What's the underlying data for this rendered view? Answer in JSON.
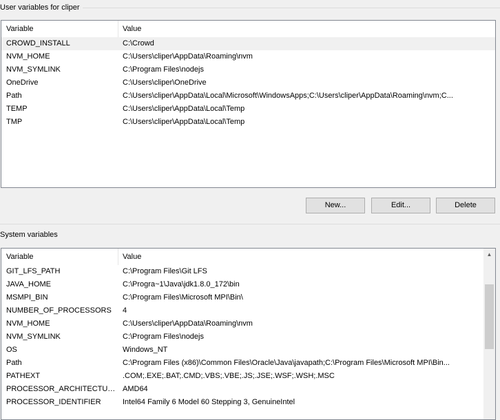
{
  "user_group": {
    "title": "User variables for cliper",
    "columns": [
      "Variable",
      "Value"
    ],
    "rows": [
      {
        "variable": "CROWD_INSTALL",
        "value": "C:\\Crowd",
        "selected": true
      },
      {
        "variable": "NVM_HOME",
        "value": "C:\\Users\\cliper\\AppData\\Roaming\\nvm"
      },
      {
        "variable": "NVM_SYMLINK",
        "value": "C:\\Program Files\\nodejs"
      },
      {
        "variable": "OneDrive",
        "value": "C:\\Users\\cliper\\OneDrive"
      },
      {
        "variable": "Path",
        "value": "C:\\Users\\cliper\\AppData\\Local\\Microsoft\\WindowsApps;C:\\Users\\cliper\\AppData\\Roaming\\nvm;C..."
      },
      {
        "variable": "TEMP",
        "value": "C:\\Users\\cliper\\AppData\\Local\\Temp"
      },
      {
        "variable": "TMP",
        "value": "C:\\Users\\cliper\\AppData\\Local\\Temp"
      }
    ],
    "buttons": {
      "new": "New...",
      "edit": "Edit...",
      "delete": "Delete"
    }
  },
  "system_group": {
    "title": "System variables",
    "columns": [
      "Variable",
      "Value"
    ],
    "rows": [
      {
        "variable": "GIT_LFS_PATH",
        "value": "C:\\Program Files\\Git LFS"
      },
      {
        "variable": "JAVA_HOME",
        "value": "C:\\Progra~1\\Java\\jdk1.8.0_172\\bin"
      },
      {
        "variable": "MSMPI_BIN",
        "value": "C:\\Program Files\\Microsoft MPI\\Bin\\"
      },
      {
        "variable": "NUMBER_OF_PROCESSORS",
        "value": "4"
      },
      {
        "variable": "NVM_HOME",
        "value": "C:\\Users\\cliper\\AppData\\Roaming\\nvm"
      },
      {
        "variable": "NVM_SYMLINK",
        "value": "C:\\Program Files\\nodejs"
      },
      {
        "variable": "OS",
        "value": "Windows_NT"
      },
      {
        "variable": "Path",
        "value": "C:\\Program Files (x86)\\Common Files\\Oracle\\Java\\javapath;C:\\Program Files\\Microsoft MPI\\Bin..."
      },
      {
        "variable": "PATHEXT",
        "value": ".COM;.EXE;.BAT;.CMD;.VBS;.VBE;.JS;.JSE;.WSF;.WSH;.MSC"
      },
      {
        "variable": "PROCESSOR_ARCHITECTURE",
        "value": "AMD64"
      },
      {
        "variable": "PROCESSOR_IDENTIFIER",
        "value": "Intel64 Family 6 Model 60 Stepping 3, GenuineIntel"
      }
    ],
    "scrollbar": {
      "icons": [
        "scroll-up-arrow-icon",
        "scroll-down-arrow-icon"
      ]
    }
  }
}
